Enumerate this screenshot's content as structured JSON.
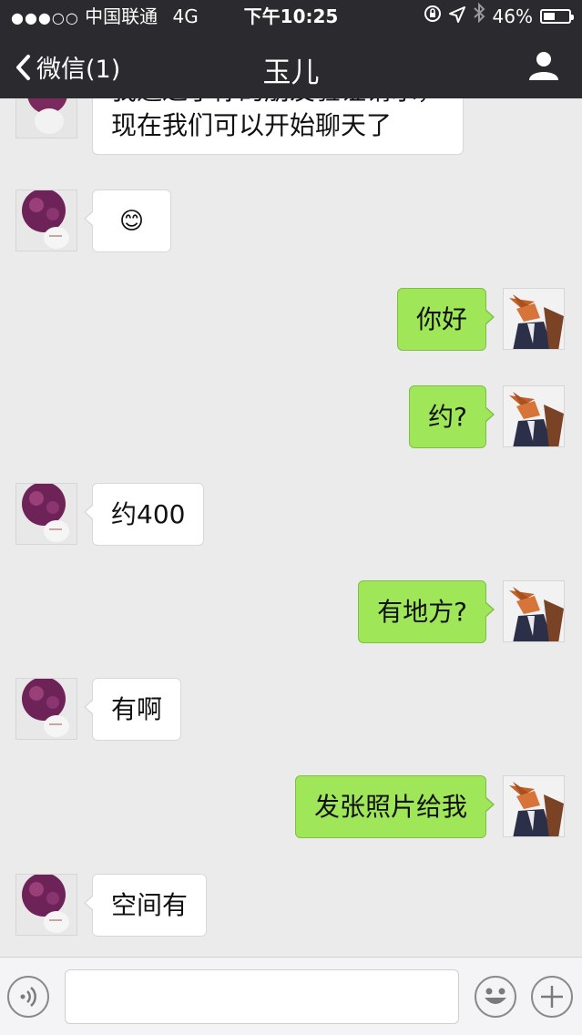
{
  "status_bar": {
    "signal": "●●●○○",
    "carrier": "中国联通",
    "network": "4G",
    "time": "下午10:25",
    "battery_percent": "46%",
    "battery_level": 0.46
  },
  "nav": {
    "back_label": "微信(1)",
    "title": "玉儿"
  },
  "messages": [
    {
      "side": "left",
      "text_lines": [
        "我通过了你的朋友验证请求，",
        "现在我们可以开始聊天了"
      ]
    },
    {
      "side": "left",
      "text": "😊"
    },
    {
      "side": "right",
      "text": "你好"
    },
    {
      "side": "right",
      "text": "约?"
    },
    {
      "side": "left",
      "text": "约400"
    },
    {
      "side": "right",
      "text": "有地方?"
    },
    {
      "side": "left",
      "text": "有啊"
    },
    {
      "side": "right",
      "text": "发张照片给我"
    },
    {
      "side": "left",
      "text": "空间有"
    }
  ],
  "colors": {
    "header_bg": "#2b2b2f",
    "chat_bg": "#ebebeb",
    "sent_bubble": "#9fe658",
    "received_bubble": "#ffffff"
  },
  "icons": {
    "back": "chevron-left-icon",
    "profile": "person-icon",
    "voice": "voice-icon",
    "emoji": "emoji-icon",
    "plus": "plus-icon",
    "avatar_left": "rose-avatar",
    "avatar_right": "fox-avatar"
  }
}
